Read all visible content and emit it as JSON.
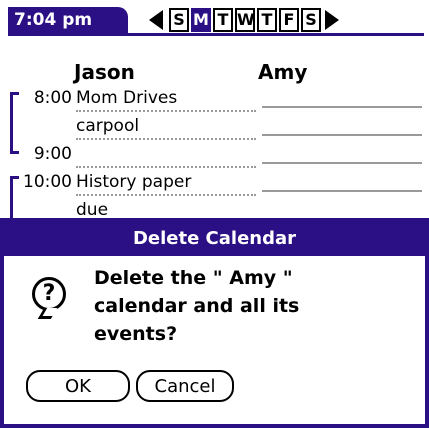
{
  "header": {
    "time": "7:04 pm",
    "days": [
      "S",
      "M",
      "T",
      "W",
      "T",
      "F",
      "S"
    ],
    "active_day_index": 1
  },
  "columns": {
    "left": "Jason",
    "right": "Amy"
  },
  "schedule": [
    {
      "time": "8:00",
      "event_line1": "Mom Drives",
      "event_line2": "carpool"
    },
    {
      "time": "9:00",
      "event_line1": "",
      "event_line2": ""
    },
    {
      "time": "10:00",
      "event_line1": "History paper",
      "event_line2": "due"
    }
  ],
  "dialog": {
    "title": "Delete Calendar",
    "message_line1": "Delete the \" Amy \"",
    "message_line2": "calendar and all its",
    "message_line3": "events?",
    "ok_label": "OK",
    "cancel_label": "Cancel"
  },
  "colors": {
    "accent": "#2b0f84"
  }
}
